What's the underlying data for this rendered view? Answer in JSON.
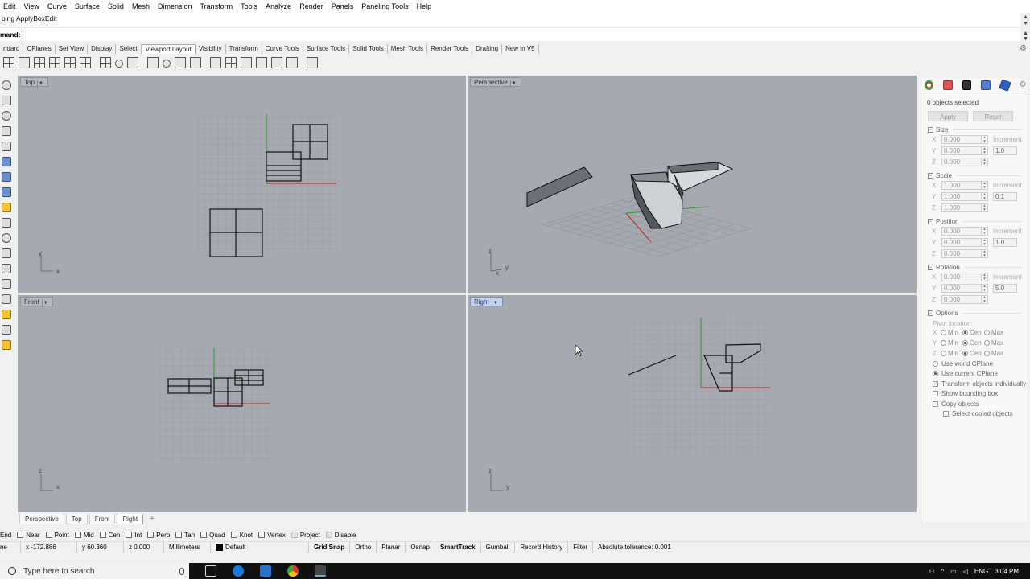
{
  "menu": [
    "Edit",
    "View",
    "Curve",
    "Surface",
    "Solid",
    "Mesh",
    "Dimension",
    "Transform",
    "Tools",
    "Analyze",
    "Render",
    "Panels",
    "Paneling Tools",
    "Help"
  ],
  "history_line": "oing ApplyBoxEdit",
  "command": {
    "label": "mand:",
    "value": ""
  },
  "toolbar_tabs": [
    "ndard",
    "CPlanes",
    "Set View",
    "Display",
    "Select",
    "Viewport Layout",
    "Visibility",
    "Transform",
    "Curve Tools",
    "Surface Tools",
    "Solid Tools",
    "Mesh Tools",
    "Render Tools",
    "Drafting",
    "New in V5"
  ],
  "active_toolbar_tab": "Viewport Layout",
  "viewports": {
    "top": {
      "title": "Top",
      "axis_a": "y",
      "axis_b": "x"
    },
    "perspective": {
      "title": "Perspective",
      "axis_a": "z",
      "axis_b": "y",
      "axis_c": "x"
    },
    "front": {
      "title": "Front",
      "axis_a": "z",
      "axis_b": "x"
    },
    "right": {
      "title": "Right",
      "axis_a": "z",
      "axis_b": "y"
    }
  },
  "viewport_tabs": [
    "Perspective",
    "Top",
    "Front",
    "Right"
  ],
  "active_viewport_tab": "Right",
  "panel": {
    "selection": "0 objects selected",
    "apply": "Apply",
    "reset": "Reset",
    "size": {
      "title": "Size",
      "x": "0.000",
      "y": "0.000",
      "z": "0.000",
      "increment_label": "Increment",
      "increment": "1.0"
    },
    "scale": {
      "title": "Scale",
      "x": "1.000",
      "y": "1.000",
      "z": "1.000",
      "increment_label": "Increment",
      "increment": "0.1"
    },
    "position": {
      "title": "Position",
      "x": "0.000",
      "y": "0.000",
      "z": "0.000",
      "increment_label": "Increment",
      "increment": "1.0"
    },
    "rotation": {
      "title": "Rotation",
      "x": "0.000",
      "y": "0.000",
      "z": "0.000",
      "increment_label": "Increment",
      "increment": "5.0"
    },
    "options": {
      "title": "Options",
      "pivot_label": "Pivot location:",
      "pivot_opts": [
        "Min",
        "Cen",
        "Max"
      ],
      "checks": [
        "Use world CPlane",
        "Use current CPlane",
        "Transform objects individually",
        "Show bounding box",
        "Copy objects",
        "Select copied objects"
      ]
    }
  },
  "osnaps": [
    "End",
    "Near",
    "Point",
    "Mid",
    "Cen",
    "Int",
    "Perp",
    "Tan",
    "Quad",
    "Knot",
    "Vertex",
    "Project",
    "Disable"
  ],
  "status": {
    "plane": "ne",
    "x": "x -172.886",
    "y": "y 60.360",
    "z": "z 0.000",
    "units": "Millimeters",
    "layer": "Default",
    "grid_snap": "Grid Snap",
    "ortho": "Ortho",
    "planar": "Planar",
    "osnap": "Osnap",
    "smarttrack": "SmartTrack",
    "gumball": "Gumball",
    "record_history": "Record History",
    "filter": "Filter",
    "tolerance": "Absolute tolerance: 0.001"
  },
  "taskbar": {
    "search_placeholder": "Type here to search",
    "language": "ENG",
    "time": "3:04 PM"
  },
  "colors": {
    "viewport_bg": "#a6a9b0",
    "grid_line": "#8f9298",
    "axis_x": "#b3262a",
    "axis_y": "#2f9a35",
    "active_tab": "#1d3f8a"
  }
}
